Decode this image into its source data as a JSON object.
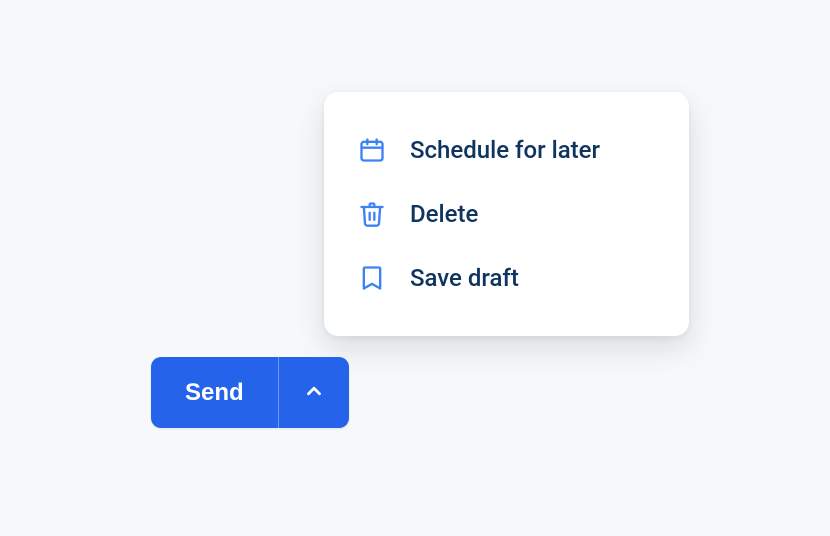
{
  "button": {
    "send_label": "Send"
  },
  "menu": {
    "items": [
      {
        "label": "Schedule for later",
        "icon": "calendar-icon"
      },
      {
        "label": "Delete",
        "icon": "trash-icon"
      },
      {
        "label": "Save draft",
        "icon": "bookmark-icon"
      }
    ]
  }
}
